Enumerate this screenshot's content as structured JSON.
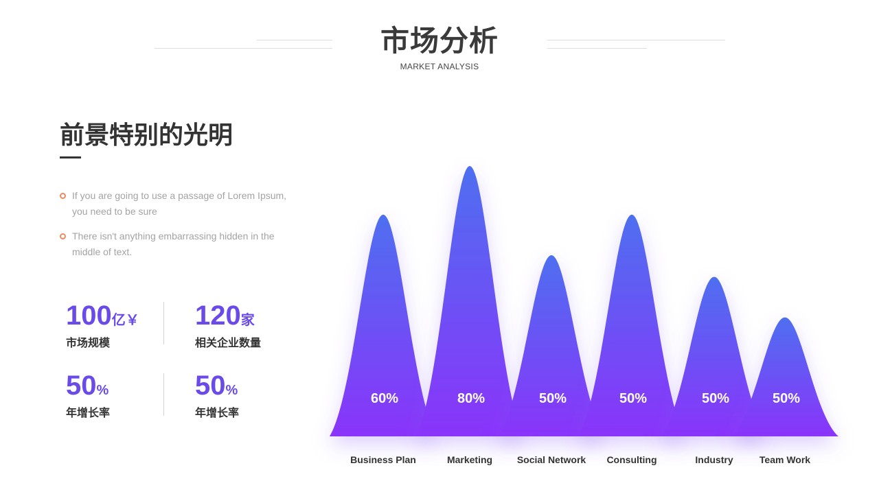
{
  "header": {
    "title": "市场分析",
    "subtitle": "MARKET ANALYSIS"
  },
  "section": {
    "heading": "前景特别的光明",
    "bullets": [
      "If you are going to use a passage of Lorem Ipsum, you need to be sure",
      "There isn't anything embarrassing hidden in the middle of text."
    ]
  },
  "stats": [
    {
      "value": "100",
      "unit": "亿￥",
      "label": "市场规模"
    },
    {
      "value": "120",
      "unit": "家",
      "label": "相关企业数量"
    },
    {
      "value": "50",
      "unit": "%",
      "label": "年增长率"
    },
    {
      "value": "50",
      "unit": "%",
      "label": "年增长率"
    }
  ],
  "colors": {
    "accent": "#6a4bea",
    "bullet": "#f08a5d",
    "peak_top": "#4e6ff0",
    "peak_bottom": "#8a34fa"
  },
  "chart_data": {
    "type": "area",
    "categories": [
      "Business Plan",
      "Marketing",
      "Social Network",
      "Consulting",
      "Industry",
      "Team Work"
    ],
    "data_labels": [
      "60%",
      "80%",
      "50%",
      "50%",
      "50%",
      "50%"
    ],
    "relative_heights": [
      0.82,
      1.0,
      0.67,
      0.82,
      0.59,
      0.44
    ],
    "legend": "none",
    "grid": false
  }
}
